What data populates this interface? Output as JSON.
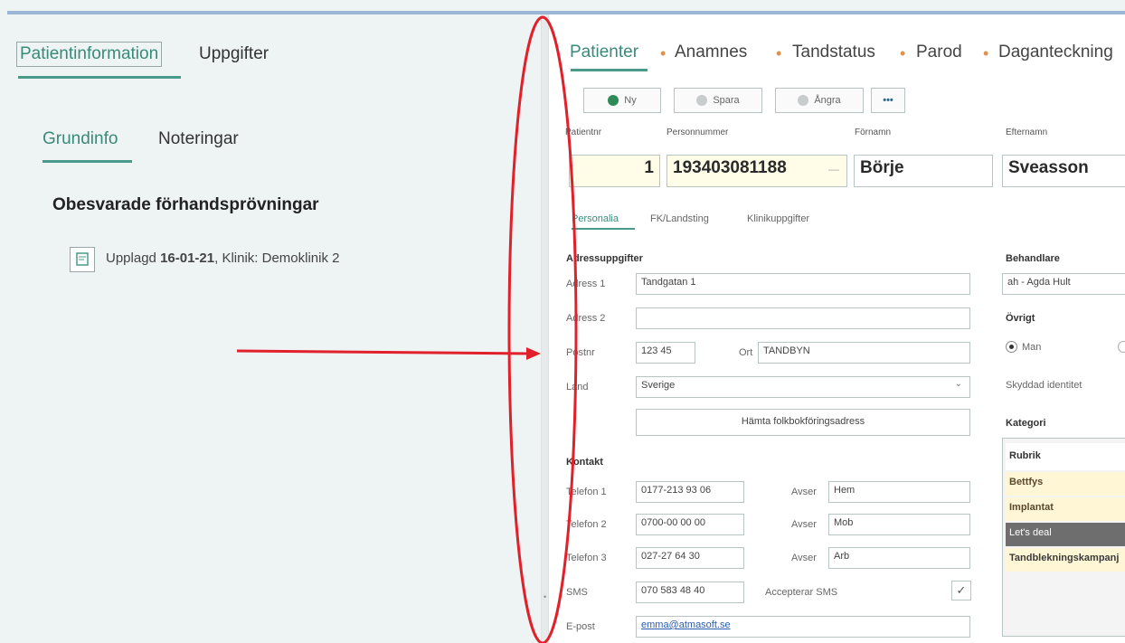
{
  "left": {
    "tabs": [
      "Patientinformation",
      "Uppgifter"
    ],
    "subtabs": [
      "Grundinfo",
      "Noteringar"
    ],
    "section_title": "Obesvarade förhandsprövningar",
    "entry": {
      "prefix": "Upplagd",
      "date": "16-01-21",
      "rest": ", Klinik: Demoklinik 2"
    }
  },
  "nav": [
    "Patienter",
    "Anamnes",
    "Tandstatus",
    "Parod",
    "Daganteckning"
  ],
  "toolbar": {
    "new": "Ny",
    "save": "Spara",
    "undo": "Ångra",
    "more": "•••"
  },
  "patient": {
    "nr_label": "Patientnr",
    "nr": "1",
    "pnr_label": "Personnummer",
    "pnr": "193403081188",
    "first_label": "Förnamn",
    "first": "Börje",
    "last_label": "Efternamn",
    "last": "Sveasson"
  },
  "subtabs": [
    "Personalia",
    "FK/Landsting",
    "Klinikuppgifter"
  ],
  "address": {
    "title": "Adressuppgifter",
    "a1_label": "Adress 1",
    "a1": "Tandgatan 1",
    "a2_label": "Adress 2",
    "a2": "",
    "postnr_label": "Postnr",
    "postnr": "123 45",
    "ort_label": "Ort",
    "ort": "TANDBYN",
    "land_label": "Land",
    "land": "Sverige",
    "fetch_button": "Hämta folkbokföringsadress"
  },
  "contact": {
    "title": "Kontakt",
    "t1_label": "Telefon 1",
    "t1": "0177-213 93 06",
    "t1_avser_label": "Avser",
    "t1_avser": "Hem",
    "t2_label": "Telefon 2",
    "t2": "0700-00 00 00",
    "t2_avser_label": "Avser",
    "t2_avser": "Mob",
    "t3_label": "Telefon 3",
    "t3": "027-27 64 30",
    "t3_avser_label": "Avser",
    "t3_avser": "Arb",
    "sms_label": "SMS",
    "sms": "070 583 48 40",
    "accept_label": "Accepterar SMS",
    "email_label": "E-post",
    "email": "emma@atmasoft.se"
  },
  "side": {
    "behandlare_label": "Behandlare",
    "behandlare": "ah - Agda Hult",
    "ovrigt_label": "Övrigt",
    "gender": "Man",
    "skyddad": "Skyddad identitet",
    "kategori_label": "Kategori",
    "kategori_header": "Rubrik",
    "kategori_items": [
      "Bettfys",
      "Implantat",
      "Let's deal",
      "Tandblekningskampanj"
    ]
  },
  "colors": {
    "accent": "#4a9a8a",
    "orange": "#e0924a",
    "annotation": "#e0202a"
  }
}
